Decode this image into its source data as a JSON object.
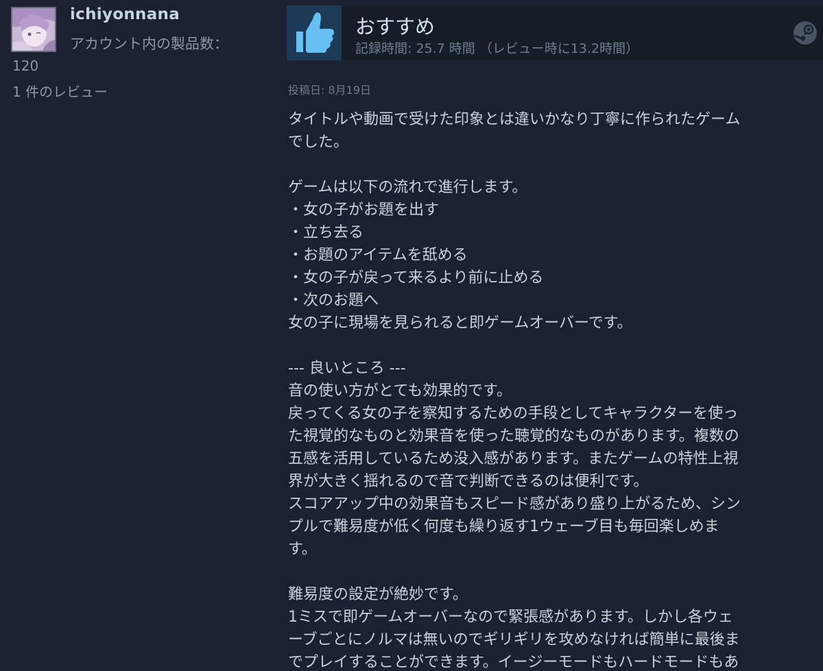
{
  "reviewer": {
    "name": "ichiyonnana",
    "products_label": "アカウント内の製品数：",
    "products_count": "120",
    "reviews": "1 件のレビュー"
  },
  "review": {
    "rating": "おすすめ",
    "playtime": "記録時間: 25.7 時間 （レビュー時に13.2時間）",
    "posted": "投稿日: 8月19日",
    "lines": [
      "タイトルや動画で受けた印象とは違いかなり丁寧に作られたゲーム",
      "でした。",
      "",
      "ゲームは以下の流れで進行します。",
      "・女の子がお題を出す",
      "・立ち去る",
      "・お題のアイテムを舐める",
      "・女の子が戻って来るより前に止める",
      "・次のお題へ",
      "女の子に現場を見られると即ゲームオーバーです。",
      "",
      "--- 良いところ ---",
      "音の使い方がとても効果的です。",
      "戻ってくる女の子を察知するための手段としてキャラクターを使っ",
      "た視覚的なものと効果音を使った聴覚的なものがあります。複数の",
      "五感を活用しているため没入感があります。またゲームの特性上視",
      "界が大きく揺れるので音で判断できるのは便利です。",
      "スコアアップ中の効果音もスピード感があり盛り上がるため、シン",
      "プルで難易度が低く何度も繰り返す1ウェーブ目も毎回楽しめま",
      "す。",
      "",
      "難易度の設定が絶妙です。",
      "1ミスで即ゲームオーバーなので緊張感があります。しかし各ウェ",
      "ーブごとにノルマは無いのでギリギリを攻めなければ簡単に最後ま",
      "でプレイすることができます。イージーモードもハードモードもあ"
    ]
  },
  "icons": {
    "rating_icon": "thumbs-up-icon",
    "platform_icon": "steam-icon"
  },
  "colors": {
    "background": "#1b2130",
    "header_background": "#171d27",
    "thumb_background": "#1d3a57",
    "thumb_color": "#66c0f4",
    "text": "#c8d2da"
  }
}
